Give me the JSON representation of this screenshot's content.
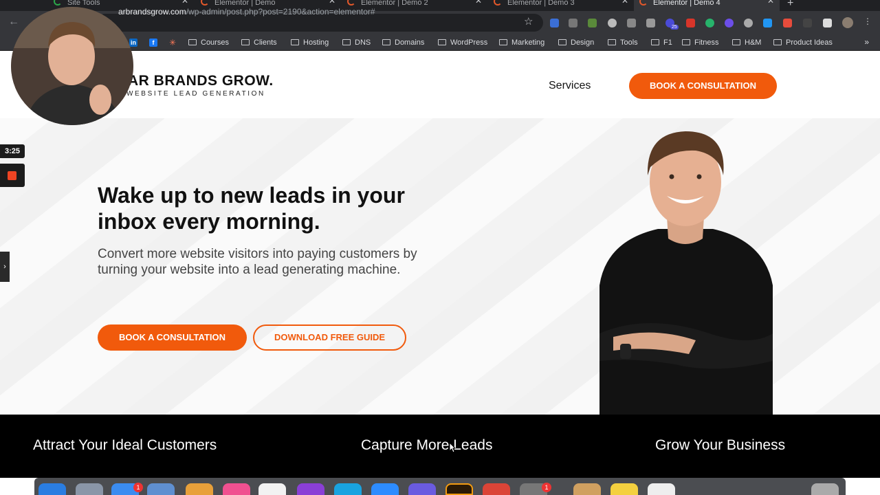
{
  "browser": {
    "tabs": [
      {
        "label": "Site Tools",
        "active": false
      },
      {
        "label": "Elementor | Demo",
        "active": false
      },
      {
        "label": "Elementor | Demo 2",
        "active": false
      },
      {
        "label": "Elementor | Demo 3",
        "active": false
      },
      {
        "label": "Elementor | Demo 4",
        "active": true
      }
    ],
    "url_domain": "arbrandsgrow.com",
    "url_path": "/wp-admin/post.php?post=2190&action=elementor#",
    "extension_badge": "25",
    "bookmarks": [
      "Courses",
      "Clients",
      "Hosting",
      "DNS",
      "Domains",
      "WordPress",
      "Marketing",
      "Design",
      "Tools",
      "F1",
      "Fitness",
      "H&M",
      "Product Ideas"
    ],
    "bookmark_icons": [
      "in",
      "f",
      "✳"
    ]
  },
  "site": {
    "logo_main": "AR BRANDS GROW.",
    "logo_sub": "WEBSITE LEAD GENERATION",
    "nav_services": "Services",
    "header_cta": "BOOK A CONSULTATION",
    "hero_title": "Wake up to new leads in your inbox every morning.",
    "hero_sub": "Convert more website visitors into paying customers by turning your website into a lead generating machine.",
    "btn_book": "BOOK A CONSULTATION",
    "btn_guide": "DOWNLOAD FREE GUIDE",
    "features": [
      "Attract Your Ideal Customers",
      "Capture More Leads",
      "Grow Your Business"
    ],
    "accent_color": "#f15a0c"
  },
  "recording": {
    "timer": "3:25"
  },
  "dock": {
    "badges": [
      "1",
      "1"
    ]
  }
}
